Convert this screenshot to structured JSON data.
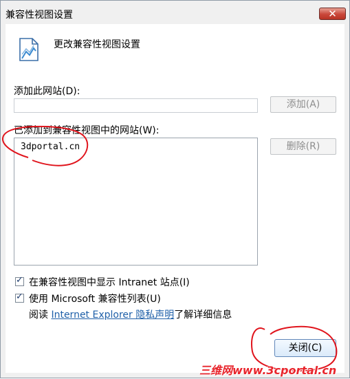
{
  "window": {
    "title": "兼容性视图设置",
    "close_icon": "close-icon"
  },
  "header": {
    "title": "更改兼容性视图设置",
    "icon": "compat-view-icon"
  },
  "add_site": {
    "label": "添加此网站(D):",
    "value": "",
    "button_label": "添加(A)"
  },
  "sites": {
    "label": "已添加到兼容性视图中的网站(W):",
    "items": [
      "3dportal.cn"
    ],
    "remove_label": "删除(R)"
  },
  "options": {
    "intranet": {
      "checked": true,
      "label": "在兼容性视图中显示 Intranet 站点(I)"
    },
    "ms_list": {
      "checked": true,
      "label": "使用 Microsoft 兼容性列表(U)"
    },
    "privacy_prefix": "阅读 ",
    "privacy_link": "Internet Explorer 隐私声明",
    "privacy_suffix": "了解详细信息"
  },
  "footer": {
    "close_label": "关闭(C)"
  },
  "watermark": {
    "text": "三维网www.3cportal.cn"
  },
  "colors": {
    "annotation": "#e0141c",
    "link": "#1e5fa8",
    "titlebar_close": "#c9473a"
  }
}
